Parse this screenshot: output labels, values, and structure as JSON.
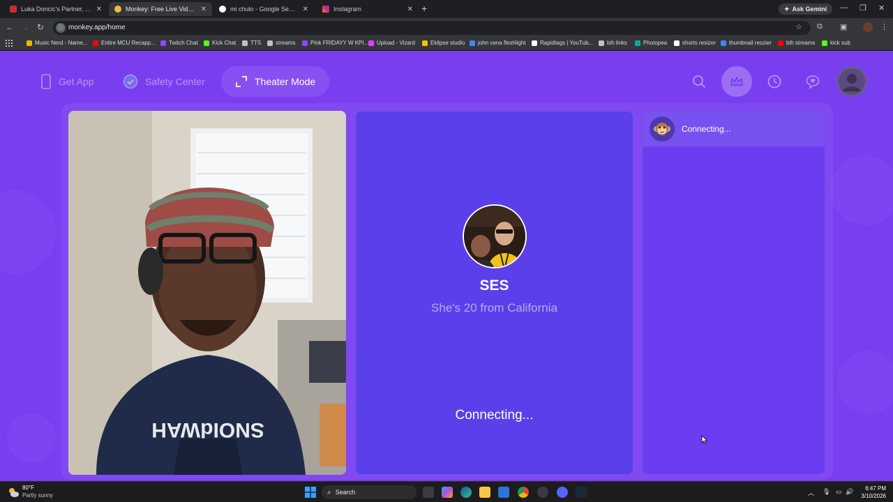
{
  "browser": {
    "tabs": [
      {
        "label": "Luka Doncic's Partner, Anamari...",
        "active": false
      },
      {
        "label": "Monkey: Free Live Video Ch...",
        "active": true
      },
      {
        "label": "mi chulo - Google Search",
        "active": false
      },
      {
        "label": "Instagram",
        "active": false
      }
    ],
    "new_tab_glyph": "+",
    "gemini_label": "Ask Gemini",
    "url": "monkey.app/home",
    "bookmarks": [
      {
        "label": "Music Nerd - Name...",
        "color": "#f4b400"
      },
      {
        "label": "Entire MCU Recapp...",
        "color": "#ff0000"
      },
      {
        "label": "Twitch Chat",
        "color": "#9146ff"
      },
      {
        "label": "Kick Chat",
        "color": "#53fc18"
      },
      {
        "label": "TTS",
        "color": "#bdc1c6"
      },
      {
        "label": "streams",
        "color": "#bdc1c6"
      },
      {
        "label": "Pink FRIDAYY W KPI...",
        "color": "#9146ff"
      },
      {
        "label": "Upload - Vizard",
        "color": "#e040fb"
      },
      {
        "label": "Eklipse studio",
        "color": "#fbbc04"
      },
      {
        "label": "john cena fleshlight",
        "color": "#4285f4"
      },
      {
        "label": "Rapidtags | YouTub...",
        "color": "#ffffff"
      },
      {
        "label": "bih links",
        "color": "#bdc1c6"
      },
      {
        "label": "Photopea",
        "color": "#18a497"
      },
      {
        "label": "shorts resizer",
        "color": "#ffffff"
      },
      {
        "label": "thumbnail reszier",
        "color": "#4285f4"
      },
      {
        "label": "bih streams",
        "color": "#ff0000"
      },
      {
        "label": "kick sub",
        "color": "#53fc18"
      }
    ]
  },
  "app": {
    "brand_color": "#7a3ef1",
    "nav": {
      "get_app": "Get App",
      "safety_center": "Safety Center",
      "theater_mode": "Theater Mode"
    },
    "peer": {
      "name": "SES",
      "subtitle": "She's 20 from California",
      "status": "Connecting..."
    },
    "chat": {
      "status": "Connecting..."
    }
  },
  "taskbar": {
    "weather_temp": "80°F",
    "weather_desc": "Partly sunny",
    "search_label": "Search",
    "time": "6:47 PM",
    "date": "3/10/2026"
  }
}
